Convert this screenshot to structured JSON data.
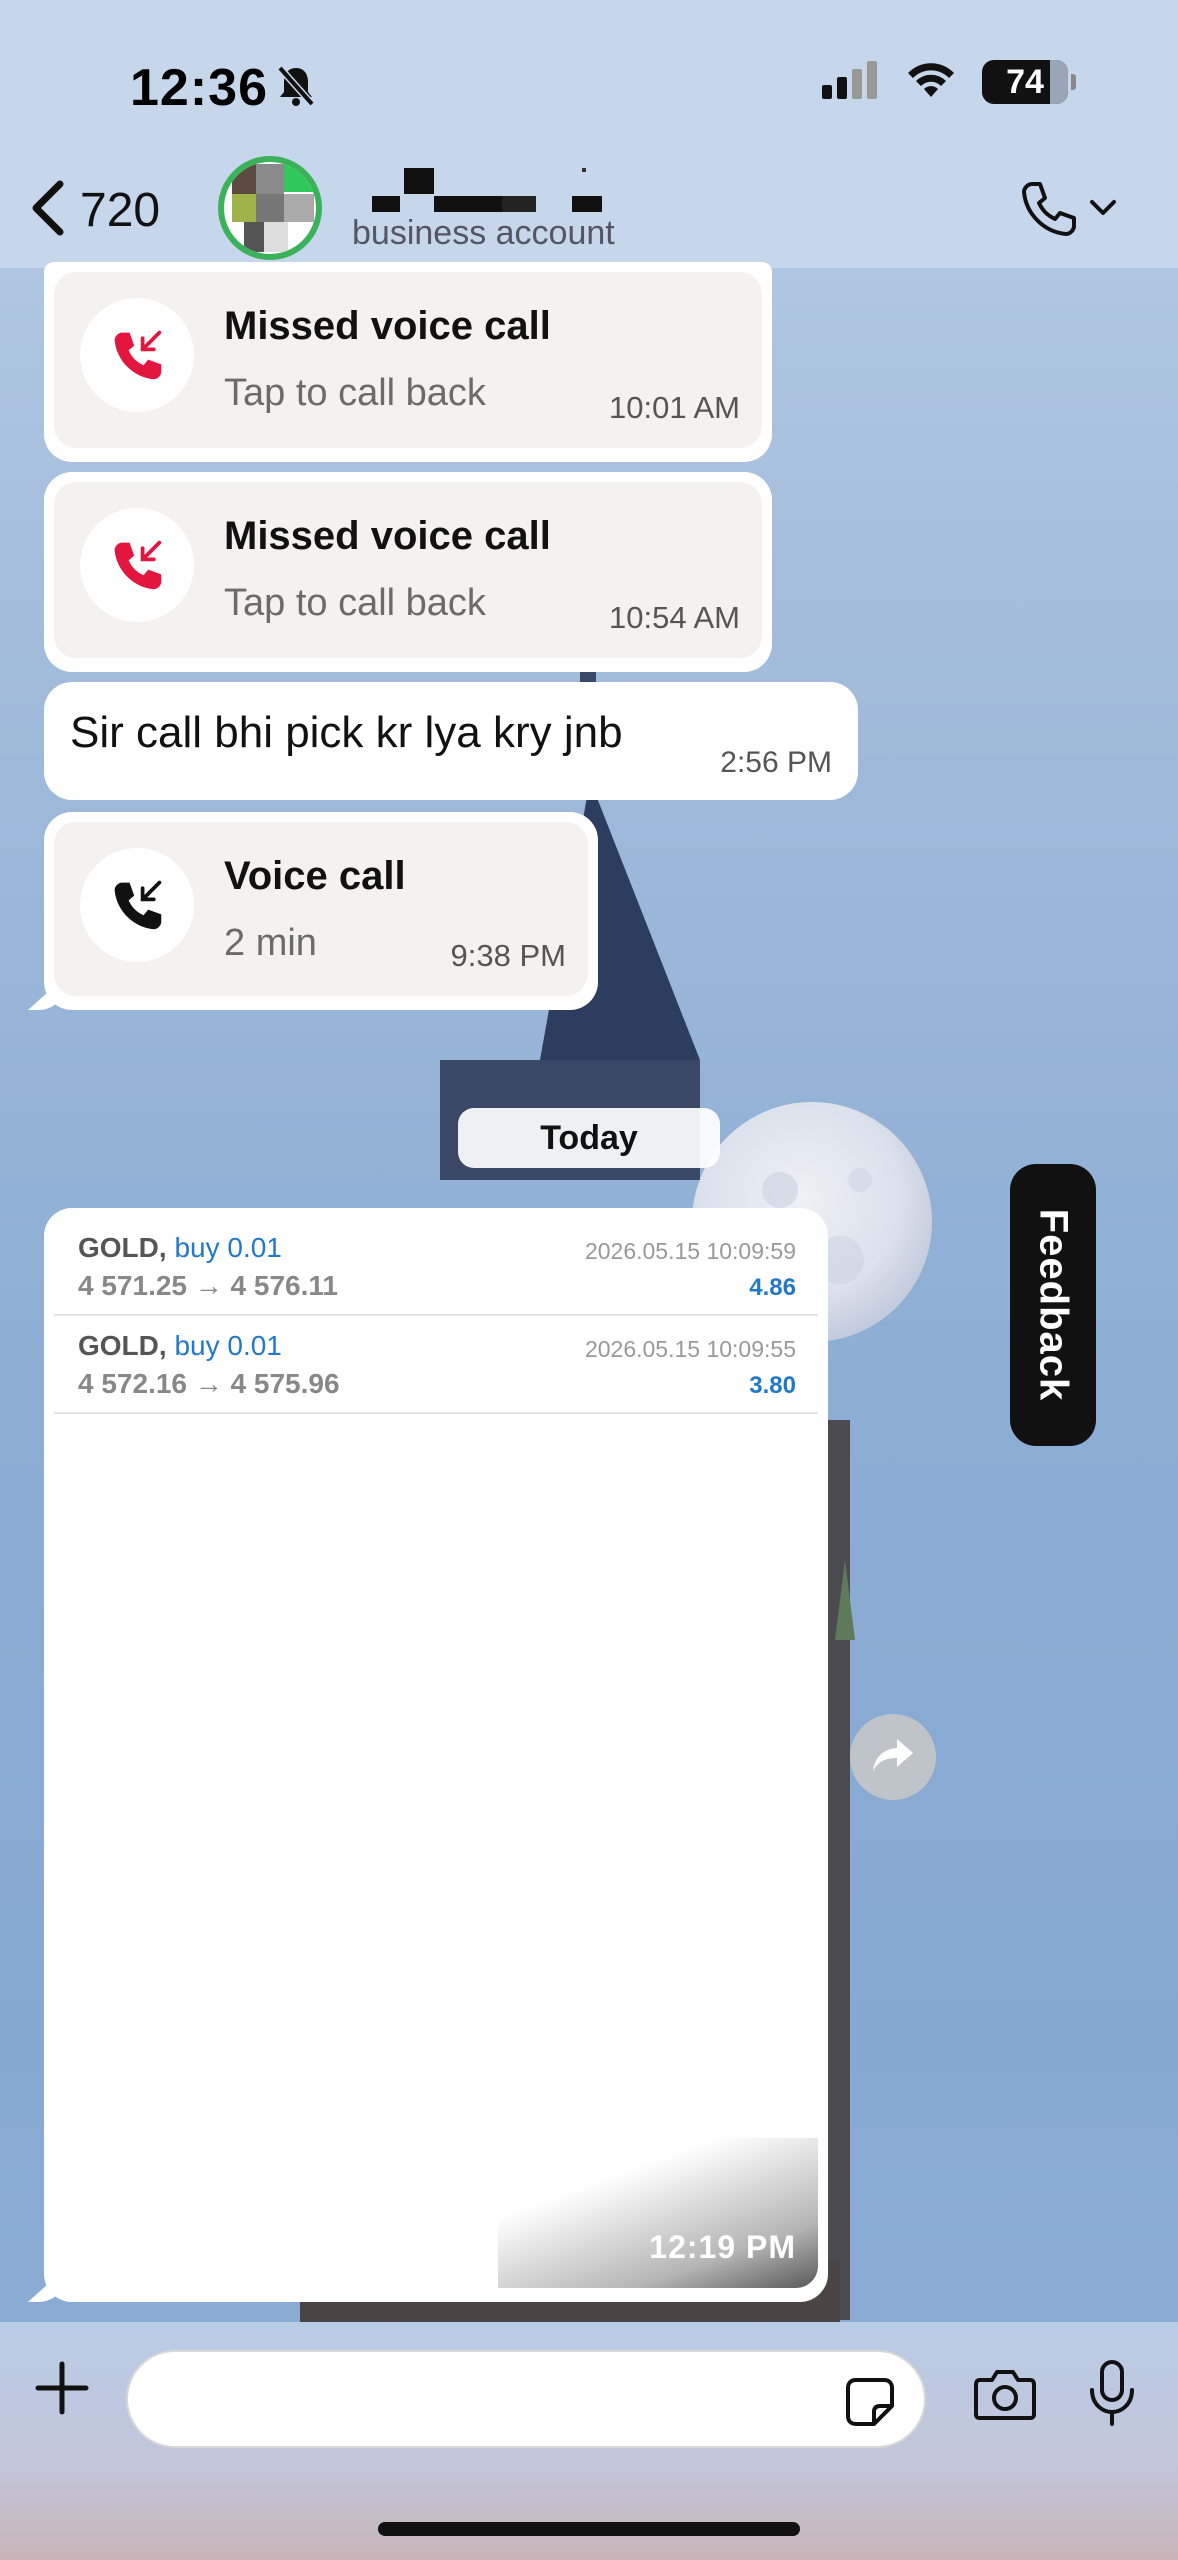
{
  "status_bar": {
    "time": "12:36",
    "battery": "74"
  },
  "header": {
    "back_count": "720",
    "subtitle": "business account"
  },
  "messages": [
    {
      "type": "missed_call",
      "title": "Missed voice call",
      "subtitle": "Tap to call back",
      "time": "10:01 AM"
    },
    {
      "type": "missed_call",
      "title": "Missed voice call",
      "subtitle": "Tap to call back",
      "time": "10:54 AM"
    },
    {
      "type": "text",
      "text": "Sir call bhi pick kr lya kry jnb",
      "time": "2:56 PM"
    },
    {
      "type": "voice_call",
      "title": "Voice call",
      "subtitle": "2 min",
      "time": "9:38 PM"
    }
  ],
  "date_divider": "Today",
  "image_message": {
    "time": "12:19 PM",
    "trades": [
      {
        "symbol": "GOLD,",
        "side": "buy 0.01",
        "prices": "4 571.25 → 4 576.11",
        "date": "2026.05.15 10:09:59",
        "profit": "4.86"
      },
      {
        "symbol": "GOLD,",
        "side": "buy 0.01",
        "prices": "4 572.16 → 4 575.96",
        "date": "2026.05.15 10:09:55",
        "profit": "3.80"
      }
    ]
  },
  "feedback_label": "Feedback",
  "input": {
    "placeholder": ""
  },
  "colors": {
    "missed_call": "#e3163f",
    "online_ring": "#3bb15a",
    "trade_blue": "#2279c8"
  }
}
